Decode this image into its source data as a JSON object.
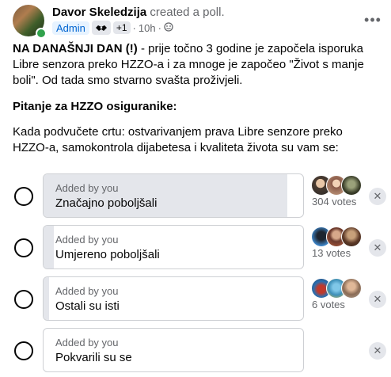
{
  "post": {
    "author": "Davor Skeledzija",
    "action": "created a poll.",
    "badges": {
      "admin": "Admin",
      "icon": "handshake-icon",
      "plus": "+1"
    },
    "time": "10h",
    "separator": "·",
    "paragraph1_bold": "NA DANAŠNJI DAN (!)",
    "paragraph1_rest": " - prije točno 3 godine je započela isporuka Libre senzora preko HZZO-a i za mnoge je započeo \"Život s manje boli\". Od tada smo stvarno svašta proživjeli.",
    "paragraph2": "Pitanje za HZZO osiguranike:",
    "paragraph3": "Kada podvučete crtu: ostvarivanjem prava Libre senzore preko HZZO-a, samokontrola dijabetesa i kvaliteta života su vam se:"
  },
  "poll": {
    "options": [
      {
        "added_by": "Added by you",
        "text": "Značajno poboljšali",
        "votes": "304 votes",
        "vote_count": 304,
        "fill_fraction": 0.94,
        "remove": "✕"
      },
      {
        "added_by": "Added by you",
        "text": "Umjereno poboljšali",
        "votes": "13 votes",
        "vote_count": 13,
        "fill_fraction": 0.04,
        "remove": "✕"
      },
      {
        "added_by": "Added by you",
        "text": "Ostali su isti",
        "votes": "6 votes",
        "vote_count": 6,
        "fill_fraction": 0.02,
        "remove": "✕"
      },
      {
        "added_by": "Added by you",
        "text": "Pokvarili su se",
        "votes": "",
        "vote_count": 0,
        "fill_fraction": 0.0,
        "remove": "✕"
      }
    ]
  },
  "colors": {
    "accent": "#0064d1",
    "online": "#31a24c",
    "secondary_text": "#65676b",
    "fill": "#e4e6eb"
  }
}
